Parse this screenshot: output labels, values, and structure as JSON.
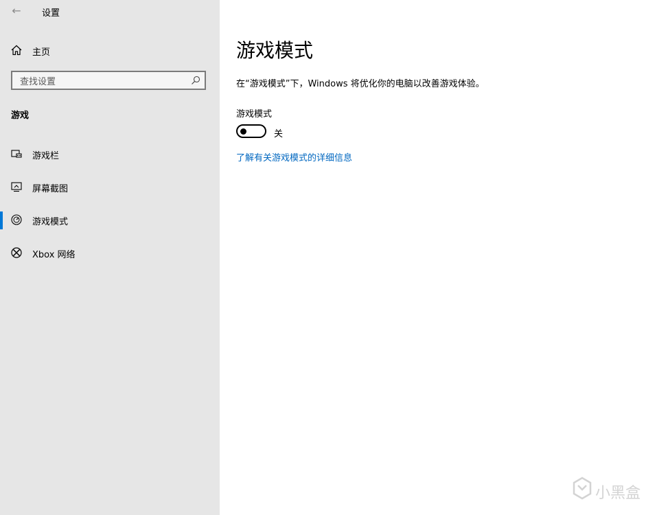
{
  "window": {
    "title": "设置"
  },
  "sidebar": {
    "home_label": "主页",
    "search_placeholder": "查找设置",
    "section_heading": "游戏",
    "items": [
      {
        "label": "游戏栏",
        "icon": "game-bar-icon",
        "active": false
      },
      {
        "label": "屏幕截图",
        "icon": "screenshot-icon",
        "active": false
      },
      {
        "label": "游戏模式",
        "icon": "game-mode-icon",
        "active": true
      },
      {
        "label": "Xbox 网络",
        "icon": "xbox-icon",
        "active": false
      }
    ]
  },
  "main": {
    "title": "游戏模式",
    "description": "在“游戏模式”下，Windows 将优化你的电脑以改善游戏体验。",
    "setting_label": "游戏模式",
    "toggle_state": "关",
    "toggle_on": false,
    "link_text": "了解有关游戏模式的详细信息"
  },
  "watermark": {
    "text": "小黑盒"
  },
  "colors": {
    "accent": "#0078d7",
    "link": "#0067c0",
    "sidebar_bg": "#e6e6e6"
  }
}
